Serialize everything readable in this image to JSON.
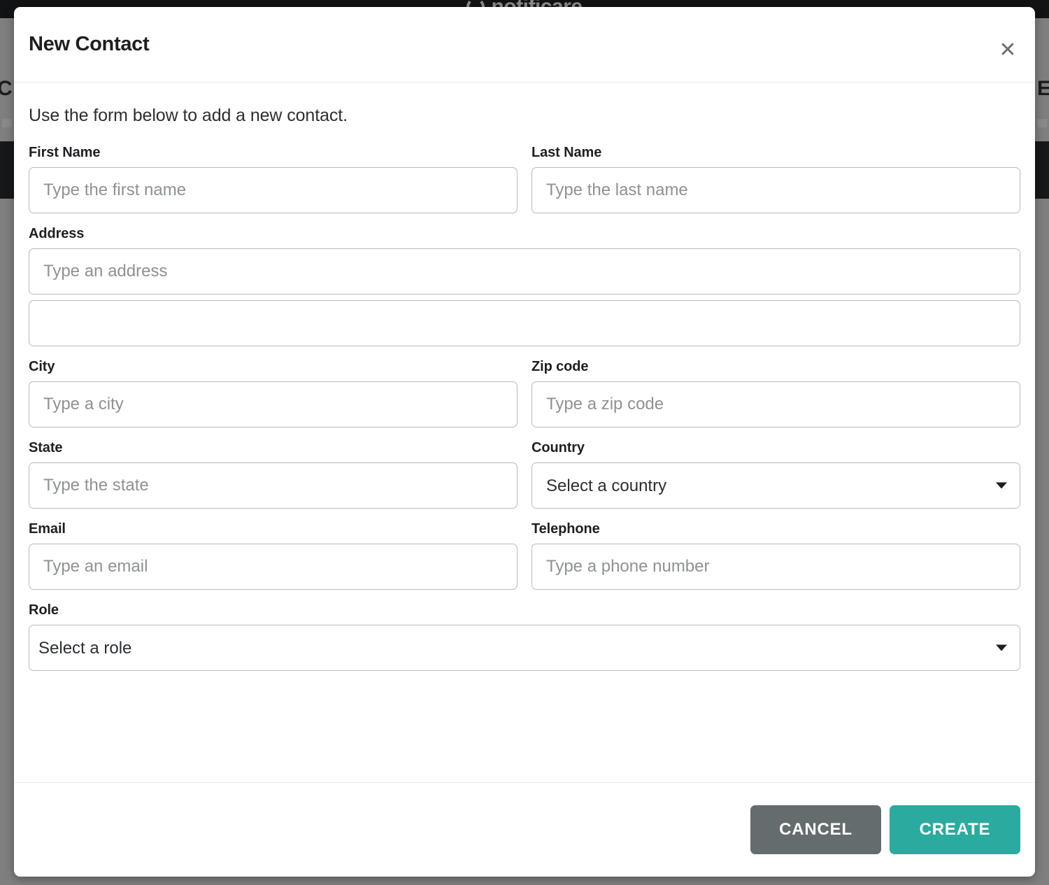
{
  "background": {
    "logo_text": "notificare",
    "edge_letter_left": "C",
    "edge_letter_right": "E"
  },
  "modal": {
    "title": "New Contact",
    "close_icon": "close-icon",
    "intro": "Use the form below to add a new contact.",
    "fields": {
      "first_name": {
        "label": "First Name",
        "placeholder": "Type the first name",
        "value": ""
      },
      "last_name": {
        "label": "Last Name",
        "placeholder": "Type the last name",
        "value": ""
      },
      "address": {
        "label": "Address",
        "placeholder": "Type an address",
        "value": ""
      },
      "address2": {
        "label": "",
        "placeholder": "",
        "value": ""
      },
      "city": {
        "label": "City",
        "placeholder": "Type a city",
        "value": ""
      },
      "zip_code": {
        "label": "Zip code",
        "placeholder": "Type a zip code",
        "value": ""
      },
      "state": {
        "label": "State",
        "placeholder": "Type the state",
        "value": ""
      },
      "country": {
        "label": "Country",
        "selected": "Select a country"
      },
      "email": {
        "label": "Email",
        "placeholder": "Type an email",
        "value": ""
      },
      "telephone": {
        "label": "Telephone",
        "placeholder": "Type a phone number",
        "value": ""
      },
      "role": {
        "label": "Role",
        "selected": "Select a role"
      }
    },
    "footer": {
      "cancel_label": "CANCEL",
      "create_label": "CREATE"
    }
  },
  "colors": {
    "accent_teal": "#2bab9f",
    "cancel_gray": "#656c6d",
    "overlay": "#7f7f7f",
    "topbar": "#111314",
    "input_border": "#b6bcbd",
    "placeholder": "#8d9294"
  }
}
